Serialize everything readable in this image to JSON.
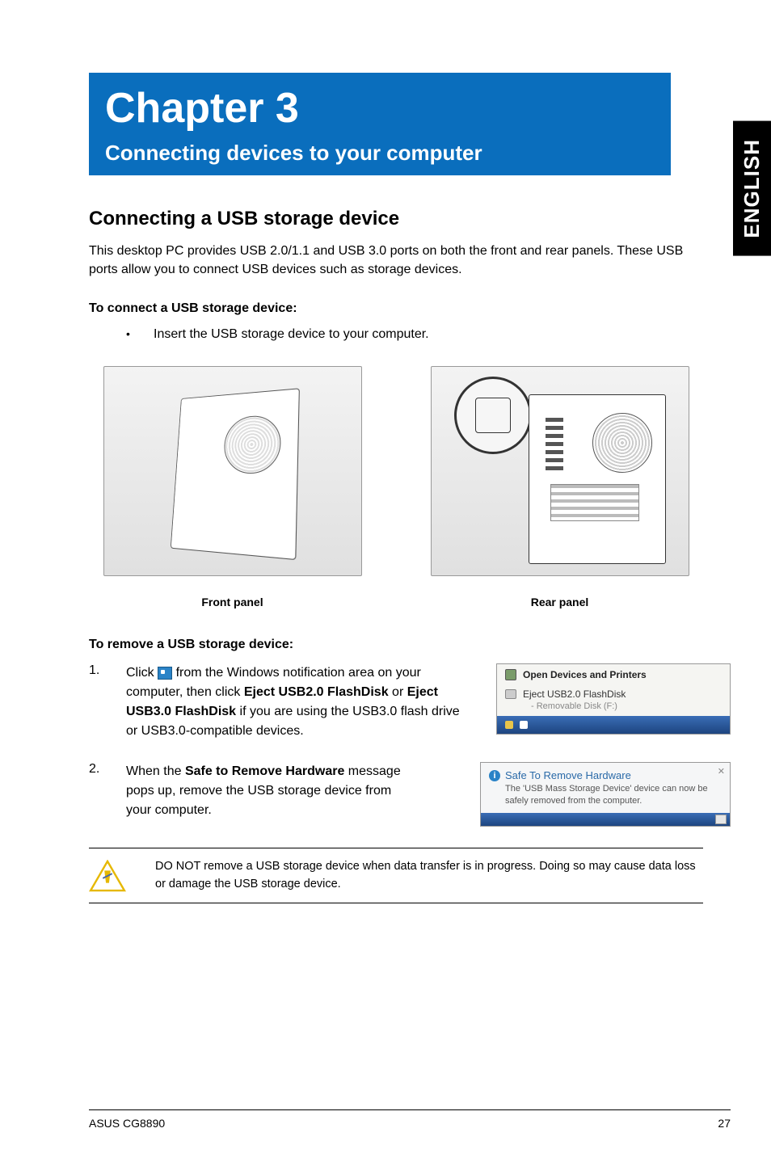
{
  "lang_tab": "ENGLISH",
  "chapter": {
    "title": "Chapter 3",
    "subtitle": "Connecting devices to your computer"
  },
  "section": {
    "heading": "Connecting a USB storage device",
    "intro": "This desktop PC provides USB 2.0/1.1 and USB 3.0 ports on both the front and rear panels. These USB ports allow you to connect USB devices such as storage devices."
  },
  "connect": {
    "heading": "To connect a USB storage device:",
    "bullet": "Insert the USB storage device to your computer."
  },
  "panels": {
    "front_caption": "Front panel",
    "rear_caption": "Rear panel"
  },
  "remove": {
    "heading": "To remove a USB storage device:",
    "step1_pre": "Click ",
    "step1_mid": " from the Windows notification area on your computer, then click ",
    "step1_bold1": "Eject USB2.0 FlashDisk",
    "step1_or": " or ",
    "step1_bold2": "Eject USB3.0 FlashDisk",
    "step1_post": " if you are using the USB3.0 flash drive or USB3.0-compatible devices.",
    "step2_pre": "When the ",
    "step2_bold": "Safe to Remove Hardware",
    "step2_post": " message pops up, remove the USB storage device from your computer."
  },
  "tray": {
    "open": "Open Devices and Printers",
    "eject": "Eject USB2.0 FlashDisk",
    "drive": "Removable Disk (F:)"
  },
  "toast": {
    "title": "Safe To Remove Hardware",
    "body": "The 'USB Mass Storage Device' device can now be safely removed from the computer.",
    "close": "✕"
  },
  "warning": "DO NOT remove a USB storage device when data transfer is in progress. Doing so may cause data loss or damage the USB storage device.",
  "footer": {
    "left": "ASUS CG8890",
    "right": "27"
  },
  "steps": {
    "n1": "1.",
    "n2": "2."
  },
  "bullet_dot": "•"
}
